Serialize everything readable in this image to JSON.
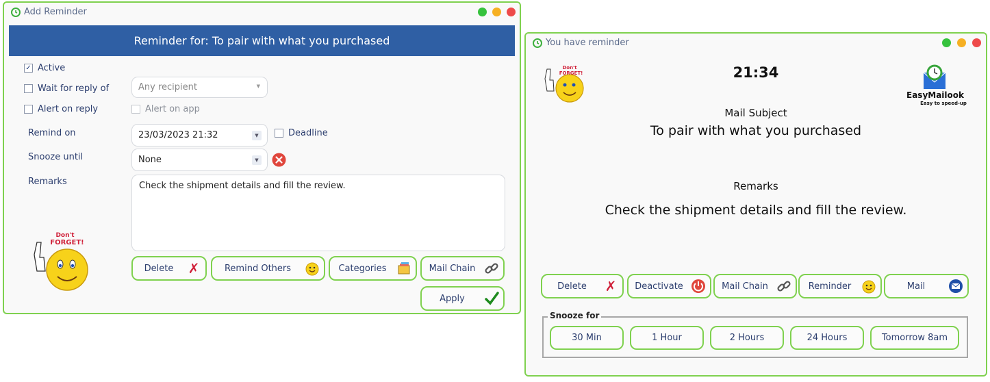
{
  "add_reminder": {
    "title": "Add Reminder",
    "header": "Reminder for: To pair with what you purchased",
    "active_label": "Active",
    "wait_reply_label": "Wait for reply of",
    "recipient_placeholder": "Any recipient",
    "alert_reply_label": "Alert on reply",
    "alert_app_label": "Alert on app",
    "remind_on_label": "Remind on",
    "remind_on_value": "23/03/2023 21:32",
    "deadline_label": "Deadline",
    "snooze_until_label": "Snooze until",
    "snooze_until_value": "None",
    "remarks_label": "Remarks",
    "remarks_value": "Check the shipment details and fill the review.",
    "buttons": {
      "delete": "Delete",
      "remind_others": "Remind Others",
      "categories": "Categories",
      "mail_chain": "Mail Chain",
      "apply": "Apply"
    },
    "sticker_top": "Don't",
    "sticker_bottom": "FORGET!",
    "active_checked": true
  },
  "you_have_reminder": {
    "title": "You have reminder",
    "time": "21:34",
    "mail_subject_label": "Mail Subject",
    "mail_subject": "To pair with what you purchased",
    "remarks_label": "Remarks",
    "remarks": "Check the shipment details and fill the review.",
    "logo_name": "EasyMailook",
    "logo_tagline": "Easy to speed-up",
    "sticker_top": "Don't",
    "sticker_bottom": "FORGET!",
    "buttons": {
      "delete": "Delete",
      "deactivate": "Deactivate",
      "mail_chain": "Mail Chain",
      "reminder": "Reminder",
      "mail": "Mail"
    },
    "snooze_for_label": "Snooze for",
    "snooze_options": [
      "30 Min",
      "1 Hour",
      "2 Hours",
      "24 Hours",
      "Tomorrow 8am"
    ]
  },
  "colors": {
    "accent_green": "#7fd14f",
    "header_blue": "#2f5fa4",
    "delete_red": "#d0213a"
  }
}
